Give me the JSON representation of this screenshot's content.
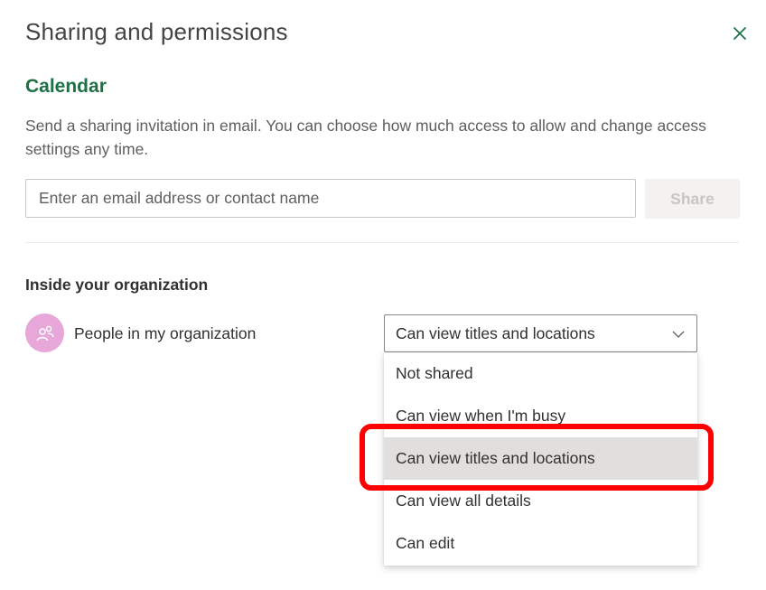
{
  "dialog": {
    "title": "Sharing and permissions",
    "close_icon": "close-icon"
  },
  "calendar": {
    "name": "Calendar",
    "description": "Send a sharing invitation in email. You can choose how much access to allow and change access settings any time."
  },
  "invite": {
    "placeholder": "Enter an email address or contact name",
    "value": "",
    "share_label": "Share"
  },
  "organization": {
    "heading": "Inside your organization",
    "avatar_icon": "people-group-icon",
    "member_label": "People in my organization",
    "permission": {
      "selected": "Can view titles and locations",
      "options": [
        "Not shared",
        "Can view when I'm busy",
        "Can view titles and locations",
        "Can view all details",
        "Can edit"
      ],
      "selected_index": 2
    }
  },
  "colors": {
    "accent": "#1e7145",
    "avatar_bg": "#e8a7d9",
    "highlight": "#ff0000",
    "selected_option_bg": "#e1dfdd"
  }
}
